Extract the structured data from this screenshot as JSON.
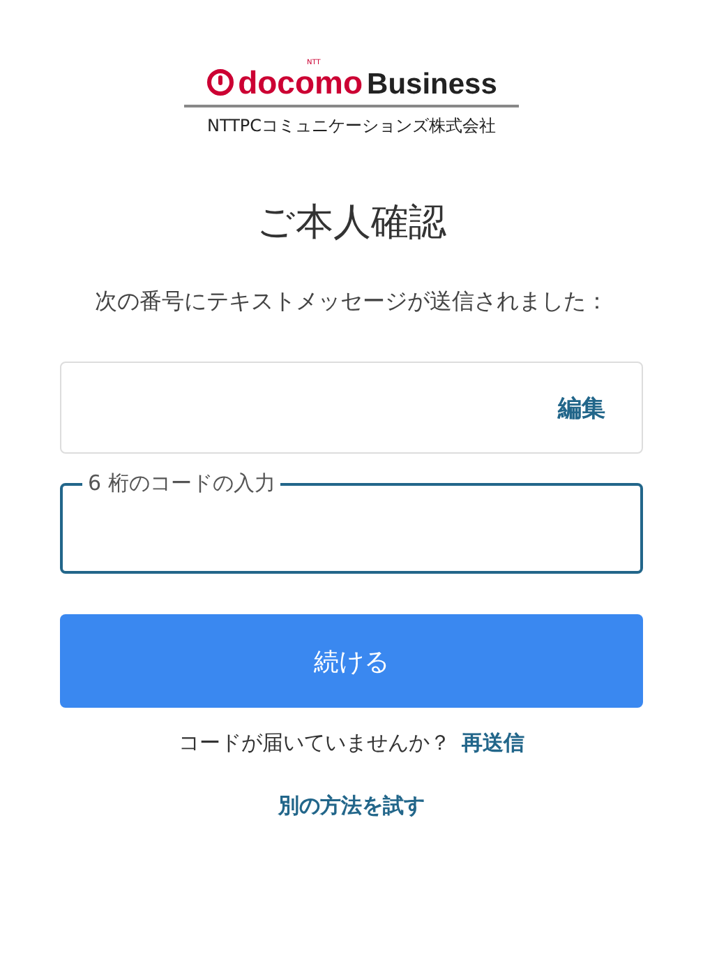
{
  "logo": {
    "tag": "NTT",
    "brand": "docomo",
    "suffix": "Business",
    "company": "NTTPCコミュニケーションズ株式会社"
  },
  "title": "ご本人確認",
  "message": "次の番号にテキストメッセージが送信されました：",
  "phone_field": {
    "action": "編集"
  },
  "code_field": {
    "label": "6 桁のコードの入力"
  },
  "submit": "続ける",
  "resend": {
    "text": "コードが届いていませんか？",
    "link": "再送信"
  },
  "alternative": "別の方法を試す"
}
